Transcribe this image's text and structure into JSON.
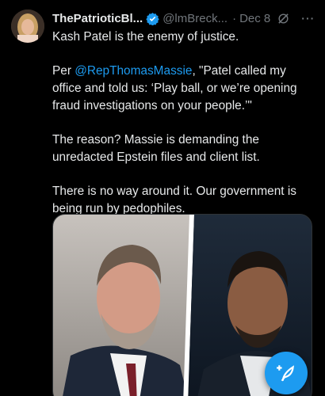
{
  "tweet": {
    "display_name": "ThePatrioticBl...",
    "handle": "@lmBreck...",
    "separator": "·",
    "date": "Dec 8",
    "more_label": "···",
    "verified_icon": "verified-badge-icon",
    "grok_icon": "grok-icon",
    "paragraphs": [
      {
        "text": "Kash Patel is the enemy of justice."
      },
      {
        "prefix": "Per ",
        "mention": "@RepThomasMassie",
        "suffix": ",  \"Patel called my office and told us: ‘Play ball, or we’re opening fraud investigations on your people.’\""
      },
      {
        "text": "The reason? Massie is demanding the unredacted Epstein files and client list."
      },
      {
        "text": "There is no way around it. Our government is being run by pedophiles."
      }
    ],
    "media_description_icon": "photo-two-men-portraits"
  },
  "compose_button": {
    "icon": "compose-feather-icon"
  },
  "colors": {
    "background": "#000000",
    "text": "#e7e9ea",
    "secondary": "#71767b",
    "accent": "#1d9bf0"
  }
}
